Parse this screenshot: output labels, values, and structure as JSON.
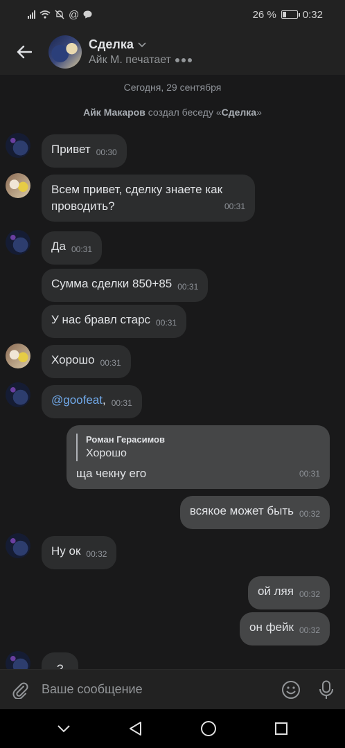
{
  "status_bar": {
    "battery": "26 %",
    "time": "0:32",
    "battery_level": 0.26
  },
  "header": {
    "title": "Сделка",
    "subtitle": "Айк М. печатает"
  },
  "chat": {
    "date": "Сегодня, 29 сентября",
    "system": {
      "author": "Айк Макаров",
      "text": " создал беседу «",
      "chat_name": "Сделка",
      "end": "»"
    },
    "messages": [
      {
        "text": "Привет",
        "time": "00:30"
      },
      {
        "text_line1": "Всем привет, сделку знаете как",
        "text_line2": "проводить?",
        "time": "00:31"
      },
      {
        "text": "Да",
        "time": "00:31"
      },
      {
        "text": "Сумма сделки 850+85",
        "time": "00:31"
      },
      {
        "text": "У нас бравл старс",
        "time": "00:31"
      },
      {
        "text": "Хорошо",
        "time": "00:31"
      },
      {
        "mention": "@goofeat",
        "suffix": ",",
        "time": "00:31"
      },
      {
        "reply_author": "Роман Герасимов",
        "reply_text": "Хорошо",
        "text": "ща чекну его",
        "time": "00:31"
      },
      {
        "text": "всякое может быть",
        "time": "00:32"
      },
      {
        "text": "Ну ок",
        "time": "00:32"
      },
      {
        "text": "ой ляя",
        "time": "00:32"
      },
      {
        "text": "он фейк",
        "time": "00:32"
      },
      {
        "text": "?"
      }
    ]
  },
  "composer": {
    "placeholder": "Ваше сообщение"
  }
}
